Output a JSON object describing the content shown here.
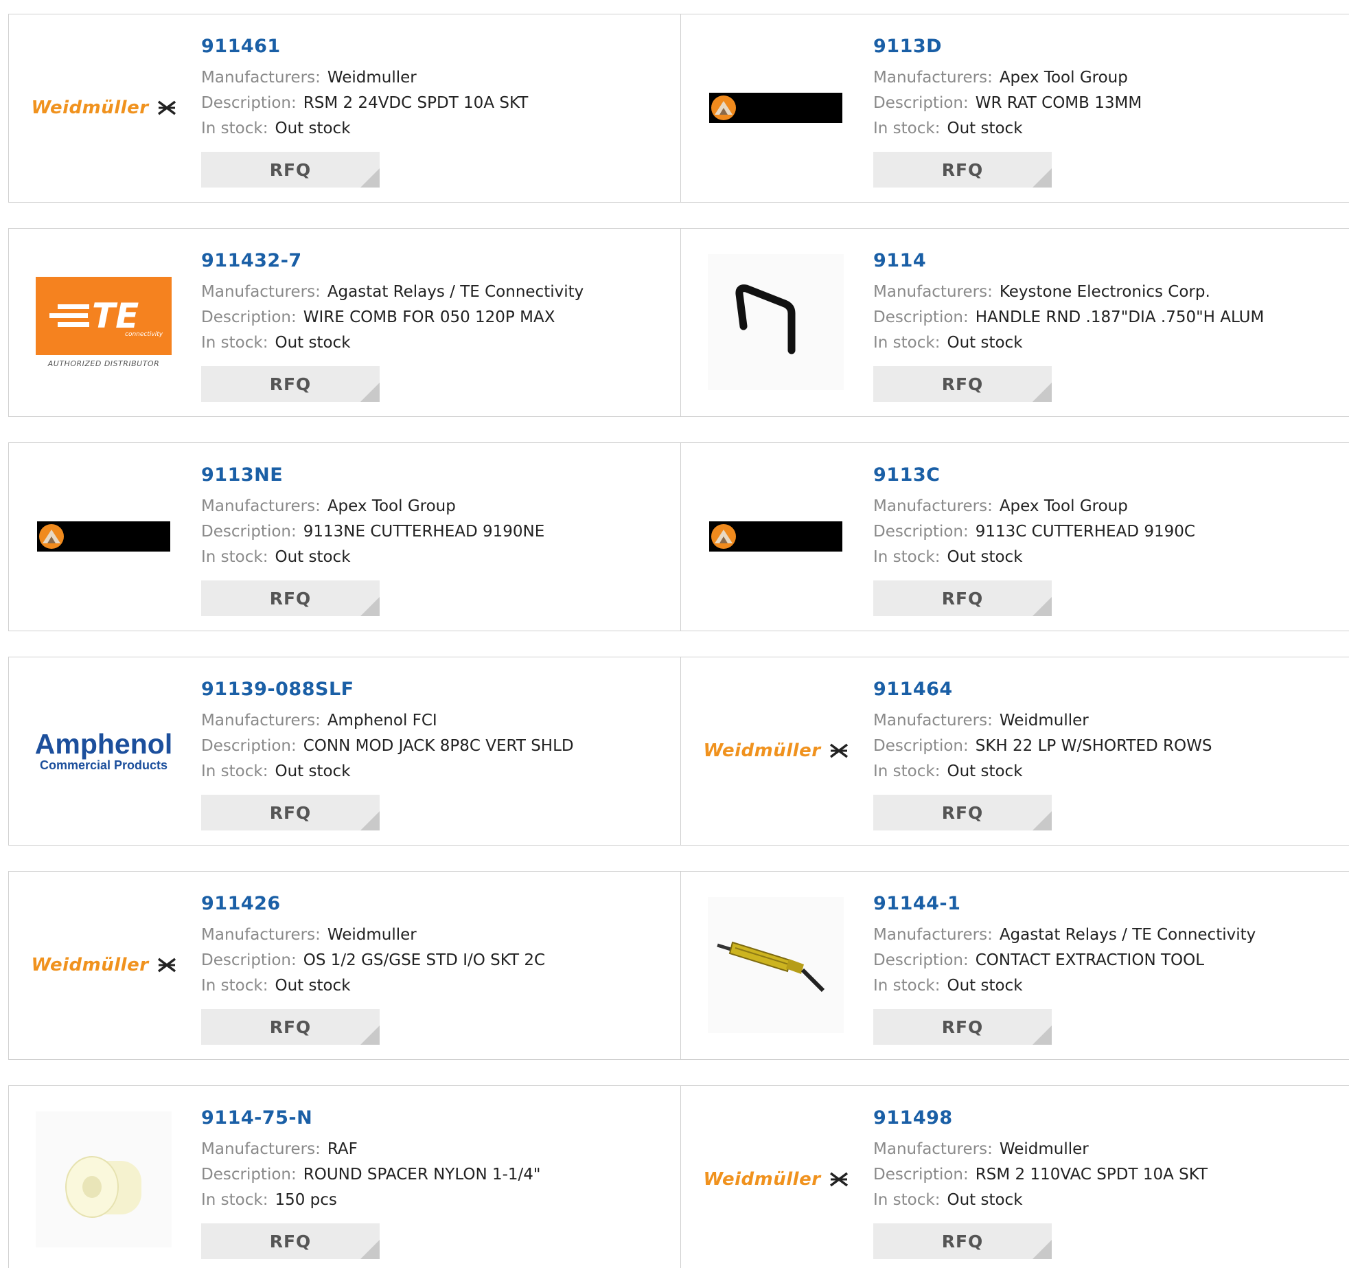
{
  "labels": {
    "manufacturers": "Manufacturers:",
    "description": "Description:",
    "stock": "In stock:",
    "rfq": "RFQ"
  },
  "products": [
    {
      "part": "911461",
      "manufacturer": "Weidmuller",
      "description": "RSM 2 24VDC SPDT 10A SKT",
      "stock": "Out stock",
      "logo": "weidmuller-logo"
    },
    {
      "part": "9113D",
      "manufacturer": "Apex Tool Group",
      "description": "WR RAT COMB 13MM",
      "stock": "Out stock",
      "logo": "apex-logo"
    },
    {
      "part": "911432-7",
      "manufacturer": "Agastat Relays / TE Connectivity",
      "description": "WIRE COMB FOR 050 120P MAX",
      "stock": "Out stock",
      "logo": "te-logo"
    },
    {
      "part": "9114",
      "manufacturer": "Keystone Electronics Corp.",
      "description": "HANDLE RND .187\"DIA .750\"H ALUM",
      "stock": "Out stock",
      "logo": "handle-photo"
    },
    {
      "part": "9113NE",
      "manufacturer": "Apex Tool Group",
      "description": "9113NE CUTTERHEAD 9190NE",
      "stock": "Out stock",
      "logo": "apex-logo"
    },
    {
      "part": "9113C",
      "manufacturer": "Apex Tool Group",
      "description": "9113C CUTTERHEAD 9190C",
      "stock": "Out stock",
      "logo": "apex-logo"
    },
    {
      "part": "91139-088SLF",
      "manufacturer": "Amphenol FCI",
      "description": "CONN MOD JACK 8P8C VERT SHLD",
      "stock": "Out stock",
      "logo": "amphenol-logo"
    },
    {
      "part": "911464",
      "manufacturer": "Weidmuller",
      "description": "SKH 22 LP W/SHORTED ROWS",
      "stock": "Out stock",
      "logo": "weidmuller-logo"
    },
    {
      "part": "911426",
      "manufacturer": "Weidmuller",
      "description": "OS 1/2 GS/GSE STD I/O SKT 2C",
      "stock": "Out stock",
      "logo": "weidmuller-logo"
    },
    {
      "part": "91144-1",
      "manufacturer": "Agastat Relays / TE Connectivity",
      "description": "CONTACT EXTRACTION TOOL",
      "stock": "Out stock",
      "logo": "extraction-tool-photo"
    },
    {
      "part": "9114-75-N",
      "manufacturer": "RAF",
      "description": "ROUND SPACER NYLON 1-1/4\"",
      "stock": "150 pcs",
      "logo": "spacer-photo"
    },
    {
      "part": "911498",
      "manufacturer": "Weidmuller",
      "description": "RSM 2 110VAC SPDT 10A SKT",
      "stock": "Out stock",
      "logo": "weidmuller-logo"
    }
  ],
  "logo_text": {
    "weidmuller": "Weidmüller",
    "te_mark": "TE",
    "te_sub": "connectivity",
    "te_badge": "AUTHORIZED DISTRIBUTOR",
    "amphenol_big": "Amphenol",
    "amphenol_small": "Commercial Products"
  },
  "colors": {
    "part_link": "#1a5fa6",
    "label": "#8a8a8a",
    "weidmuller_orange": "#f0921e",
    "te_orange": "#f5821f",
    "amphenol_blue": "#1c4f9c",
    "rfq_bg": "#ebebeb"
  }
}
